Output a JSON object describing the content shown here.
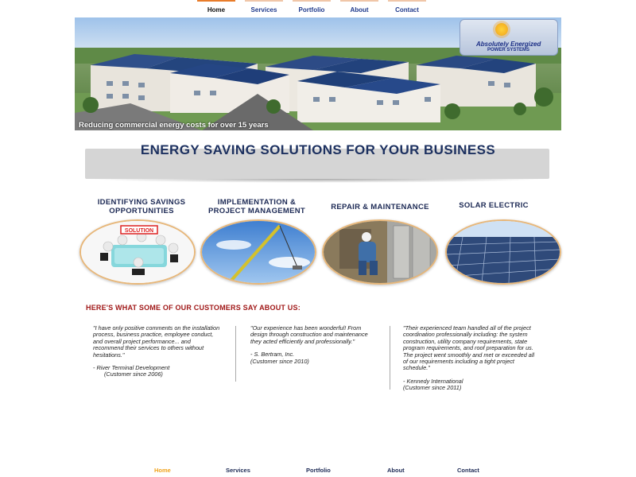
{
  "nav": {
    "items": [
      {
        "label": "Home",
        "active": true
      },
      {
        "label": "Services",
        "active": false
      },
      {
        "label": "Portfolio",
        "active": false
      },
      {
        "label": "About",
        "active": false
      },
      {
        "label": "Contact",
        "active": false
      }
    ]
  },
  "hero": {
    "caption": "Reducing commercial energy costs for over 15 years",
    "logo_line1": "Absolutely Energized",
    "logo_line2": "POWER SYSTEMS",
    "logo_icon": "sun-icon"
  },
  "banner": {
    "title": "ENERGY SAVING SOLUTIONS FOR YOUR BUSINESS"
  },
  "services": [
    {
      "title": "IDENTIFYING SAVINGS OPPORTUNITIES",
      "image_label": "SOLUTION"
    },
    {
      "title": "IMPLEMENTATION & PROJECT MANAGEMENT"
    },
    {
      "title": "REPAIR & MAINTENANCE"
    },
    {
      "title": "SOLAR ELECTRIC"
    }
  ],
  "customers": {
    "heading": "HERE'S WHAT SOME OF OUR CUSTOMERS SAY ABOUT US:",
    "quotes": [
      {
        "text": "\"I have only positive comments on the installation process, business practice, employee conduct, and overall project performance... and recommend their services to others without hesitations.\"",
        "author": "- River Terminal Development",
        "since": "(Customer since 2006)"
      },
      {
        "text": "\"Our experience has been wonderful!  From design through construction and maintenance they acted efficiently and professionally.\"",
        "author": "- S. Bertram, Inc.",
        "since": "(Customer since 2010)"
      },
      {
        "text": "\"Their experienced team handled all of the project coordination professionally including: the system construction, utility company requirements, state program requirements, and roof preparation for us.  The project went smoothly and met or exceeded all of our requirements including a tight project schedule.\"",
        "author": "- Kennedy International",
        "since": "(Customer since 2011)"
      }
    ]
  },
  "footer": {
    "items": [
      {
        "label": "Home",
        "active": true
      },
      {
        "label": "Services"
      },
      {
        "label": "Portfolio"
      },
      {
        "label": "About"
      },
      {
        "label": "Contact"
      }
    ]
  },
  "colors": {
    "nav_active_border": "#e87c2a",
    "banner_title": "#1d3160",
    "customers_heading": "#a01818",
    "footer_active": "#f0a21a"
  }
}
